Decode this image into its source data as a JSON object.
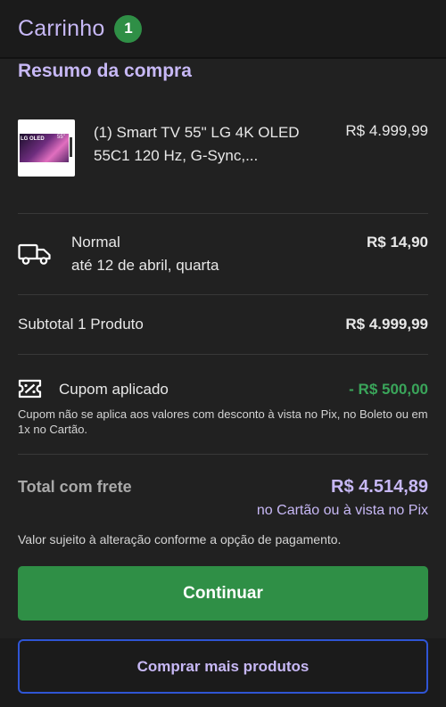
{
  "header": {
    "title": "Carrinho",
    "cart_count": "1"
  },
  "summary": {
    "title": "Resumo da compra",
    "product": {
      "name": "(1) Smart TV 55\" LG 4K OLED 55C1 120 Hz, G-Sync,...",
      "price": "R$ 4.999,99",
      "thumb_brand": "LG OLED",
      "thumb_size": "55\""
    },
    "shipping": {
      "name": "Normal",
      "date": "até 12 de abril, quarta",
      "price": "R$ 14,90"
    },
    "subtotal": {
      "label": "Subtotal 1 Produto",
      "value": "R$ 4.999,99"
    },
    "coupon": {
      "label": "Cupom aplicado",
      "value": "- R$ 500,00",
      "note": "Cupom não se aplica aos valores com desconto à vista no Pix, no Boleto ou em 1x no Cartão."
    },
    "total": {
      "label": "Total com frete",
      "value": "R$ 4.514,89",
      "subtext": "no Cartão ou à vista no Pix",
      "note": "Valor sujeito à alteração conforme a opção de pagamento."
    }
  },
  "actions": {
    "continue_label": "Continuar",
    "more_label": "Comprar mais produtos"
  },
  "colors": {
    "accent": "#c7b8f5",
    "primary_button": "#2f8f46",
    "discount": "#3aa55a",
    "outline_button_border": "#2f55d4",
    "background": "#121212",
    "card": "#212121"
  },
  "icons": {
    "shipping": "truck-icon",
    "coupon": "coupon-ticket-icon"
  }
}
